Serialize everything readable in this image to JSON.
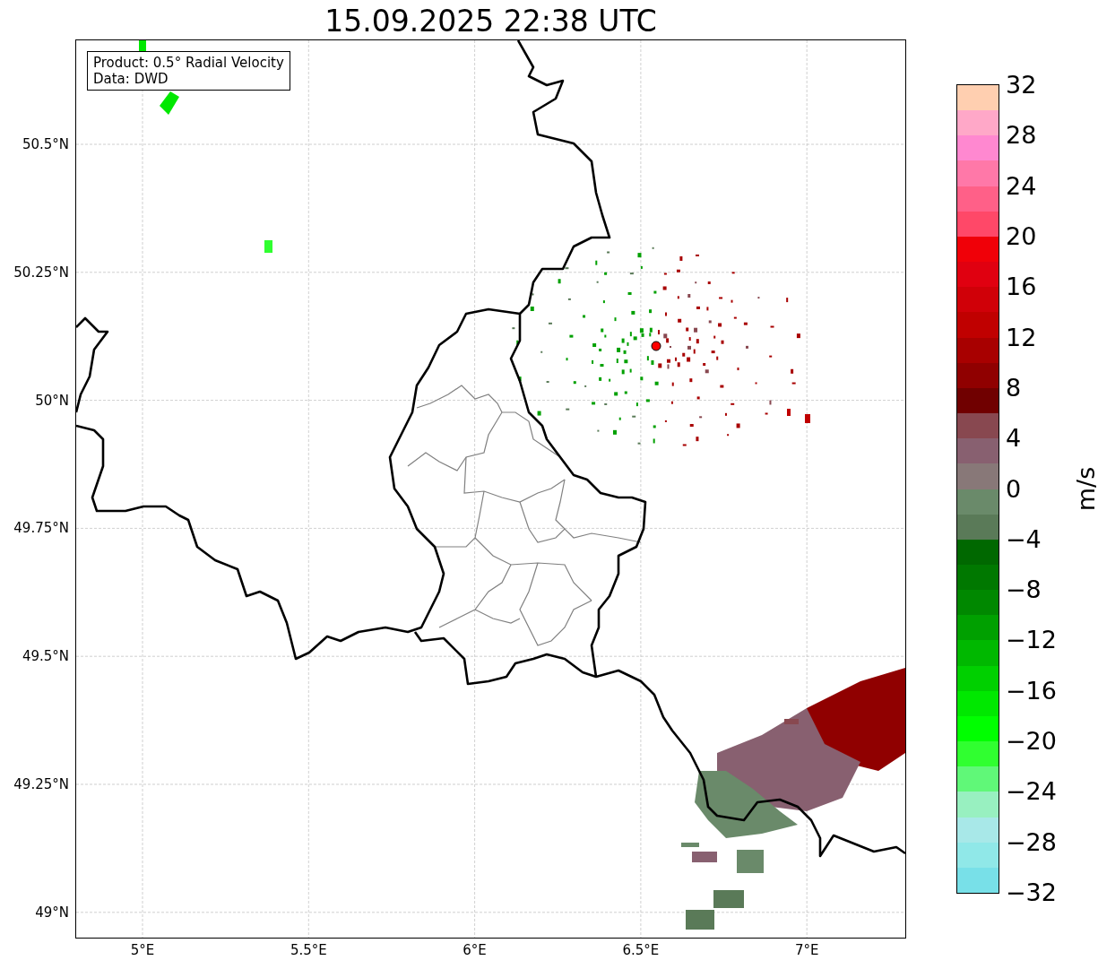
{
  "title": "15.09.2025 22:38 UTC",
  "info_box": [
    "Product: 0.5° Radial Velocity",
    "Data: DWD"
  ],
  "map": {
    "y_ticks": [
      "50.5°N",
      "50.25°N",
      "50°N",
      "49.75°N",
      "49.5°N",
      "49.25°N",
      "49°N"
    ],
    "x_ticks": [
      "5°E",
      "5.5°E",
      "6°E",
      "6.5°E",
      "7°E"
    ]
  },
  "colorbar": {
    "label": "m/s",
    "ticks": [
      "32",
      "28",
      "24",
      "20",
      "16",
      "12",
      "8",
      "4",
      "0",
      "−4",
      "−8",
      "−12",
      "−16",
      "−20",
      "−24",
      "−28",
      "−32"
    ],
    "bins": [
      {
        "color": "#ffcfb0"
      },
      {
        "color": "#ffa8c8"
      },
      {
        "color": "#ff88d0"
      },
      {
        "color": "#ff78a8"
      },
      {
        "color": "#ff6088"
      },
      {
        "color": "#ff4868"
      },
      {
        "color": "#f00008"
      },
      {
        "color": "#e00010"
      },
      {
        "color": "#d00008"
      },
      {
        "color": "#c00000"
      },
      {
        "color": "#a80000"
      },
      {
        "color": "#900000"
      },
      {
        "color": "#700000"
      },
      {
        "color": "#884850"
      },
      {
        "color": "#886070"
      },
      {
        "color": "#887878"
      },
      {
        "color": "#6a8a6a"
      },
      {
        "color": "#5a7a58"
      },
      {
        "color": "#006800"
      },
      {
        "color": "#007800"
      },
      {
        "color": "#008800"
      },
      {
        "color": "#00a000"
      },
      {
        "color": "#00b800"
      },
      {
        "color": "#00d000"
      },
      {
        "color": "#00e800"
      },
      {
        "color": "#00ff00"
      },
      {
        "color": "#30ff30"
      },
      {
        "color": "#60f878"
      },
      {
        "color": "#98f0c0"
      },
      {
        "color": "#a8e8e8"
      },
      {
        "color": "#90e8e8"
      },
      {
        "color": "#78e0e8"
      }
    ]
  }
}
